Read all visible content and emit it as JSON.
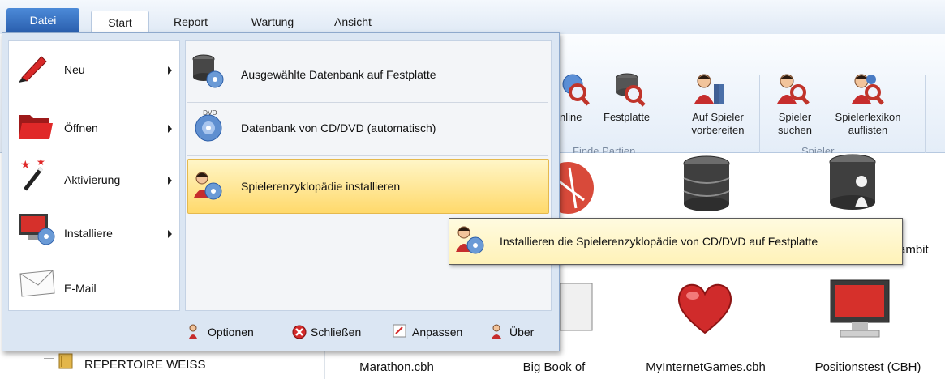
{
  "tabs": [
    "Datei",
    "Start",
    "Report",
    "Wartung",
    "Ansicht"
  ],
  "ribbon": {
    "btn_online": "nline",
    "btn_festplatte": "Festplatte",
    "group_finde": "Finde Partien",
    "btn_auf_spieler_1": "Auf Spieler",
    "btn_auf_spieler_2": "vorbereiten",
    "btn_spieler_suchen_1": "Spieler",
    "btn_spieler_suchen_2": "suchen",
    "btn_spielerlexikon_1": "Spielerlexikon",
    "btn_spielerlexikon_2": "auflisten",
    "group_spieler": "Spieler"
  },
  "file_menu": {
    "items": [
      {
        "label": "Neu",
        "icon": "pencil-icon"
      },
      {
        "label": "Öffnen",
        "icon": "folder-icon"
      },
      {
        "label": "Aktivierung",
        "icon": "magic-wand-icon"
      },
      {
        "label": "Installiere",
        "icon": "monitor-install-icon"
      },
      {
        "label": "E-Mail",
        "icon": "envelope-icon"
      }
    ],
    "submenu": [
      {
        "label": "Ausgewählte Datenbank auf Festplatte",
        "icon": "database-disk-icon"
      },
      {
        "label": "Datenbank von CD/DVD (automatisch)",
        "icon": "dvd-icon"
      },
      {
        "label": "Spielerenzyklopädie installieren",
        "icon": "player-dvd-icon"
      }
    ],
    "footer": {
      "options": "Optionen",
      "close": "Schließen",
      "customize": "Anpassen",
      "about": "Über"
    }
  },
  "tooltip": "Installieren die Spielerenzyklopädie von CD/DVD auf Festplatte",
  "content": {
    "tree_item": "REPERTOIRE WEISS",
    "partial_label": "ambit",
    "items": [
      "Marathon.cbh",
      "Big Book of",
      "MyInternetGames.cbh",
      "Positionstest (CBH)"
    ]
  },
  "colors": {
    "highlight": "#ffd96b",
    "tab_active": "#2a5fae",
    "heart": "#d02b2b"
  }
}
